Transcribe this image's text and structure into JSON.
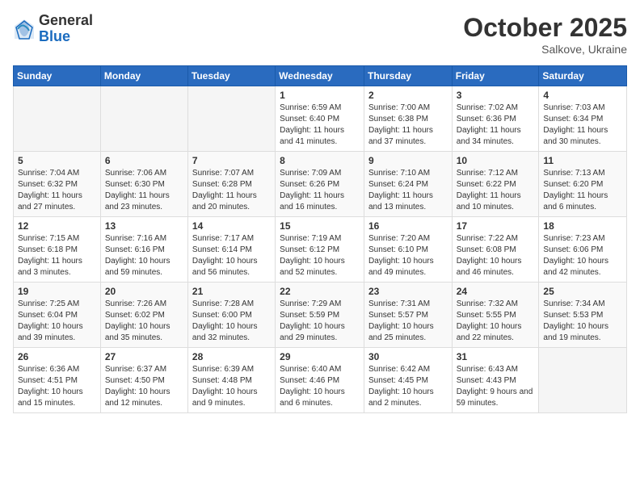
{
  "logo": {
    "general": "General",
    "blue": "Blue"
  },
  "header": {
    "month": "October 2025",
    "location": "Salkove, Ukraine"
  },
  "days_of_week": [
    "Sunday",
    "Monday",
    "Tuesday",
    "Wednesday",
    "Thursday",
    "Friday",
    "Saturday"
  ],
  "weeks": [
    [
      {
        "day": "",
        "info": ""
      },
      {
        "day": "",
        "info": ""
      },
      {
        "day": "",
        "info": ""
      },
      {
        "day": "1",
        "info": "Sunrise: 6:59 AM\nSunset: 6:40 PM\nDaylight: 11 hours and 41 minutes."
      },
      {
        "day": "2",
        "info": "Sunrise: 7:00 AM\nSunset: 6:38 PM\nDaylight: 11 hours and 37 minutes."
      },
      {
        "day": "3",
        "info": "Sunrise: 7:02 AM\nSunset: 6:36 PM\nDaylight: 11 hours and 34 minutes."
      },
      {
        "day": "4",
        "info": "Sunrise: 7:03 AM\nSunset: 6:34 PM\nDaylight: 11 hours and 30 minutes."
      }
    ],
    [
      {
        "day": "5",
        "info": "Sunrise: 7:04 AM\nSunset: 6:32 PM\nDaylight: 11 hours and 27 minutes."
      },
      {
        "day": "6",
        "info": "Sunrise: 7:06 AM\nSunset: 6:30 PM\nDaylight: 11 hours and 23 minutes."
      },
      {
        "day": "7",
        "info": "Sunrise: 7:07 AM\nSunset: 6:28 PM\nDaylight: 11 hours and 20 minutes."
      },
      {
        "day": "8",
        "info": "Sunrise: 7:09 AM\nSunset: 6:26 PM\nDaylight: 11 hours and 16 minutes."
      },
      {
        "day": "9",
        "info": "Sunrise: 7:10 AM\nSunset: 6:24 PM\nDaylight: 11 hours and 13 minutes."
      },
      {
        "day": "10",
        "info": "Sunrise: 7:12 AM\nSunset: 6:22 PM\nDaylight: 11 hours and 10 minutes."
      },
      {
        "day": "11",
        "info": "Sunrise: 7:13 AM\nSunset: 6:20 PM\nDaylight: 11 hours and 6 minutes."
      }
    ],
    [
      {
        "day": "12",
        "info": "Sunrise: 7:15 AM\nSunset: 6:18 PM\nDaylight: 11 hours and 3 minutes."
      },
      {
        "day": "13",
        "info": "Sunrise: 7:16 AM\nSunset: 6:16 PM\nDaylight: 10 hours and 59 minutes."
      },
      {
        "day": "14",
        "info": "Sunrise: 7:17 AM\nSunset: 6:14 PM\nDaylight: 10 hours and 56 minutes."
      },
      {
        "day": "15",
        "info": "Sunrise: 7:19 AM\nSunset: 6:12 PM\nDaylight: 10 hours and 52 minutes."
      },
      {
        "day": "16",
        "info": "Sunrise: 7:20 AM\nSunset: 6:10 PM\nDaylight: 10 hours and 49 minutes."
      },
      {
        "day": "17",
        "info": "Sunrise: 7:22 AM\nSunset: 6:08 PM\nDaylight: 10 hours and 46 minutes."
      },
      {
        "day": "18",
        "info": "Sunrise: 7:23 AM\nSunset: 6:06 PM\nDaylight: 10 hours and 42 minutes."
      }
    ],
    [
      {
        "day": "19",
        "info": "Sunrise: 7:25 AM\nSunset: 6:04 PM\nDaylight: 10 hours and 39 minutes."
      },
      {
        "day": "20",
        "info": "Sunrise: 7:26 AM\nSunset: 6:02 PM\nDaylight: 10 hours and 35 minutes."
      },
      {
        "day": "21",
        "info": "Sunrise: 7:28 AM\nSunset: 6:00 PM\nDaylight: 10 hours and 32 minutes."
      },
      {
        "day": "22",
        "info": "Sunrise: 7:29 AM\nSunset: 5:59 PM\nDaylight: 10 hours and 29 minutes."
      },
      {
        "day": "23",
        "info": "Sunrise: 7:31 AM\nSunset: 5:57 PM\nDaylight: 10 hours and 25 minutes."
      },
      {
        "day": "24",
        "info": "Sunrise: 7:32 AM\nSunset: 5:55 PM\nDaylight: 10 hours and 22 minutes."
      },
      {
        "day": "25",
        "info": "Sunrise: 7:34 AM\nSunset: 5:53 PM\nDaylight: 10 hours and 19 minutes."
      }
    ],
    [
      {
        "day": "26",
        "info": "Sunrise: 6:36 AM\nSunset: 4:51 PM\nDaylight: 10 hours and 15 minutes."
      },
      {
        "day": "27",
        "info": "Sunrise: 6:37 AM\nSunset: 4:50 PM\nDaylight: 10 hours and 12 minutes."
      },
      {
        "day": "28",
        "info": "Sunrise: 6:39 AM\nSunset: 4:48 PM\nDaylight: 10 hours and 9 minutes."
      },
      {
        "day": "29",
        "info": "Sunrise: 6:40 AM\nSunset: 4:46 PM\nDaylight: 10 hours and 6 minutes."
      },
      {
        "day": "30",
        "info": "Sunrise: 6:42 AM\nSunset: 4:45 PM\nDaylight: 10 hours and 2 minutes."
      },
      {
        "day": "31",
        "info": "Sunrise: 6:43 AM\nSunset: 4:43 PM\nDaylight: 9 hours and 59 minutes."
      },
      {
        "day": "",
        "info": ""
      }
    ]
  ]
}
